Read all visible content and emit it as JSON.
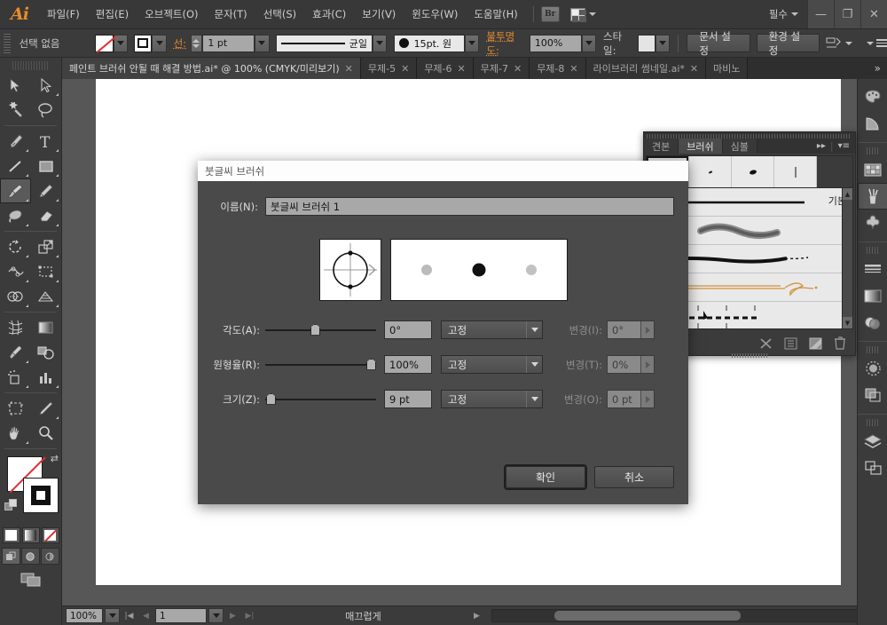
{
  "app": {
    "logo": "Ai",
    "menus": [
      {
        "label": "파일(F)"
      },
      {
        "label": "편집(E)"
      },
      {
        "label": "오브젝트(O)"
      },
      {
        "label": "문자(T)"
      },
      {
        "label": "선택(S)"
      },
      {
        "label": "효과(C)"
      },
      {
        "label": "보기(V)"
      },
      {
        "label": "윈도우(W)"
      },
      {
        "label": "도움말(H)"
      }
    ],
    "bridge_button": "Br",
    "workspace": "필수",
    "window_controls": {
      "minimize": "—",
      "maximize": "❐",
      "close": "✕"
    }
  },
  "control_bar": {
    "selection_status": "선택 없음",
    "stroke_label": "선:",
    "stroke_weight": "1 pt",
    "stroke_profile": "균일",
    "brush_definition": "15pt. 원",
    "opacity_label": "불투명도:",
    "opacity_value": "100%",
    "style_label": "스타일:",
    "document_setup": "문서 설정",
    "preferences": "환경 설정"
  },
  "tabs": [
    {
      "label": "페인트 브러쉬 안될 때 해결 방법.ai* @ 100% (CMYK/미리보기)",
      "active": true,
      "close": "✕"
    },
    {
      "label": "무제-5",
      "active": false,
      "close": "✕"
    },
    {
      "label": "무제-6",
      "active": false,
      "close": "✕"
    },
    {
      "label": "무제-7",
      "active": false,
      "close": "✕"
    },
    {
      "label": "무제-8",
      "active": false,
      "close": "✕"
    },
    {
      "label": "라이브러리 썸네일.ai*",
      "active": false,
      "close": "✕"
    },
    {
      "label": "마비노",
      "active": false,
      "close": ""
    }
  ],
  "tab_overflow": "»",
  "toolbar": {
    "tools": [
      {
        "name": "selection-tool"
      },
      {
        "name": "direct-selection-tool"
      },
      {
        "name": "magic-wand-tool"
      },
      {
        "name": "lasso-tool"
      },
      {
        "name": "pen-tool"
      },
      {
        "name": "type-tool"
      },
      {
        "name": "line-segment-tool"
      },
      {
        "name": "rectangle-tool"
      },
      {
        "name": "paintbrush-tool"
      },
      {
        "name": "pencil-tool"
      },
      {
        "name": "blob-brush-tool"
      },
      {
        "name": "eraser-tool"
      },
      {
        "name": "rotate-tool"
      },
      {
        "name": "scale-tool"
      },
      {
        "name": "width-tool"
      },
      {
        "name": "free-transform-tool"
      },
      {
        "name": "shape-builder-tool"
      },
      {
        "name": "perspective-grid-tool"
      },
      {
        "name": "mesh-tool"
      },
      {
        "name": "gradient-tool"
      },
      {
        "name": "eyedropper-tool"
      },
      {
        "name": "blend-tool"
      },
      {
        "name": "symbol-sprayer-tool"
      },
      {
        "name": "column-graph-tool"
      },
      {
        "name": "artboard-tool"
      },
      {
        "name": "slice-tool"
      },
      {
        "name": "hand-tool"
      },
      {
        "name": "zoom-tool"
      }
    ],
    "selected_tool": "paintbrush-tool",
    "fill": "없음",
    "stroke": "검정"
  },
  "panel": {
    "tabs": [
      {
        "label": "견본",
        "active": false
      },
      {
        "label": "브러쉬",
        "active": true
      },
      {
        "label": "심볼",
        "active": false
      }
    ],
    "collapse_icon": "▸▸",
    "menu_icon": "▾≡",
    "brush_rows": [
      {
        "name": "기본",
        "type": "basic-stroke"
      },
      {
        "name": "",
        "type": "soft-charcoal-stroke"
      },
      {
        "name": "",
        "type": "dry-ink-stroke"
      },
      {
        "name": "",
        "type": "arrow-art-stroke"
      },
      {
        "name": "",
        "type": "dashed-ruler-pattern"
      }
    ],
    "footer_icons": [
      {
        "name": "remove-brush-stroke-icon"
      },
      {
        "name": "brush-libraries-menu-icon"
      },
      {
        "name": "new-brush-icon"
      },
      {
        "name": "delete-brush-icon"
      }
    ]
  },
  "dock_icons": [
    {
      "name": "color-panel-icon",
      "active": false
    },
    {
      "name": "color-guide-panel-icon",
      "active": false
    },
    {
      "name": "swatches-panel-icon",
      "active": false
    },
    {
      "name": "brushes-panel-icon",
      "active": true
    },
    {
      "name": "symbols-panel-icon",
      "active": false
    },
    {
      "name": "stroke-panel-icon",
      "active": false
    },
    {
      "name": "gradient-panel-icon",
      "active": false
    },
    {
      "name": "transparency-panel-icon",
      "active": false
    },
    {
      "name": "appearance-panel-icon",
      "active": false
    },
    {
      "name": "graphic-styles-panel-icon",
      "active": false
    },
    {
      "name": "layers-panel-icon",
      "active": false
    },
    {
      "name": "artboards-panel-icon",
      "active": false
    }
  ],
  "dialog": {
    "title": "붓글씨 브러쉬",
    "name_label": "이름(N):",
    "name_value": "붓글씨 브러쉬 1",
    "preview": {
      "shape": "circle-with-crosshair",
      "samples": [
        {
          "color": "#bbbbbb",
          "size": 11
        },
        {
          "color": "#111111",
          "size": 13
        },
        {
          "color": "#c2c2c2",
          "size": 11
        }
      ]
    },
    "rows": [
      {
        "label": "각도(A):",
        "slider_percent": 45,
        "value": "0°",
        "mode": "고정",
        "variation_label": "변경(I):",
        "variation_value": "0°"
      },
      {
        "label": "원형율(R):",
        "slider_percent": 100,
        "value": "100%",
        "mode": "고정",
        "variation_label": "변경(T):",
        "variation_value": "0%"
      },
      {
        "label": "크기(Z):",
        "slider_percent": 4,
        "value": "9 pt",
        "mode": "고정",
        "variation_label": "변경(O):",
        "variation_value": "0 pt"
      }
    ],
    "ok_button": "확인",
    "cancel_button": "취소"
  },
  "status_bar": {
    "zoom": "100%",
    "page": "1",
    "status_text": "매끄럽게"
  },
  "colors": {
    "accent_orange": "#e08a2e",
    "panel_bg": "#3b3b3b",
    "dialog_bg": "#4a4a4a",
    "canvas_bg": "#575757"
  }
}
